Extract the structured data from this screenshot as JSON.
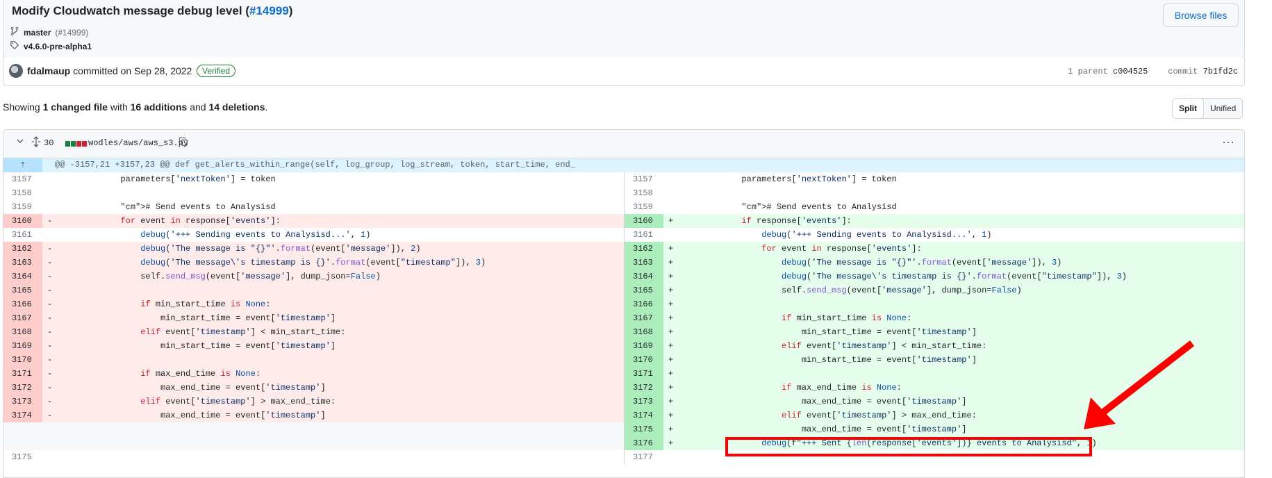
{
  "commit": {
    "title_prefix": "Modify Cloudwatch message debug level (",
    "pr_link": "#14999",
    "title_suffix": ")",
    "browse_button": "Browse files",
    "branch": "master",
    "branch_pr": "(#14999)",
    "tag": "v4.6.0-pre-alpha1",
    "author": "fdalmaup",
    "committed_text": "committed on Sep 28, 2022",
    "verified": "Verified",
    "parent_label": "1 parent",
    "parent_sha": "c004525",
    "commit_label": "commit",
    "commit_sha": "7b1fd2c"
  },
  "summary": {
    "showing": "Showing",
    "changed": "1 changed file",
    "with": "with",
    "additions": "16 additions",
    "and": "and",
    "deletions": "14 deletions",
    "period": "."
  },
  "view_toggle": {
    "split": "Split",
    "unified": "Unified"
  },
  "file": {
    "changes": "30",
    "path": "wodles/aws/aws_s3.py",
    "hunk_header": "@@ -3157,21 +3157,23 @@ def get_alerts_within_range(self, log_group, log_stream, token, start_time, end_"
  },
  "diff": {
    "left": [
      {
        "n": "3157",
        "t": "ctx",
        "m": "",
        "c": "            parameters['nextToken'] = token"
      },
      {
        "n": "3158",
        "t": "ctx",
        "m": "",
        "c": ""
      },
      {
        "n": "3159",
        "t": "ctx",
        "m": "",
        "c": "            # Send events to Analysisd"
      },
      {
        "n": "3160",
        "t": "del",
        "m": "-",
        "c": "            for event in response['events']:"
      },
      {
        "n": "3161",
        "t": "ctx",
        "m": "",
        "c": "                debug('+++ Sending events to Analysisd...', 1)"
      },
      {
        "n": "3162",
        "t": "del",
        "m": "-",
        "c": "                debug('The message is \"{}\"'.format(event['message']), 2)"
      },
      {
        "n": "3163",
        "t": "del",
        "m": "-",
        "c": "                debug('The message\\'s timestamp is {}'.format(event[\"timestamp\"]), 3)"
      },
      {
        "n": "3164",
        "t": "del",
        "m": "-",
        "c": "                self.send_msg(event['message'], dump_json=False)"
      },
      {
        "n": "3165",
        "t": "del",
        "m": "-",
        "c": ""
      },
      {
        "n": "3166",
        "t": "del",
        "m": "-",
        "c": "                if min_start_time is None:"
      },
      {
        "n": "3167",
        "t": "del",
        "m": "-",
        "c": "                    min_start_time = event['timestamp']"
      },
      {
        "n": "3168",
        "t": "del",
        "m": "-",
        "c": "                elif event['timestamp'] < min_start_time:"
      },
      {
        "n": "3169",
        "t": "del",
        "m": "-",
        "c": "                    min_start_time = event['timestamp']"
      },
      {
        "n": "3170",
        "t": "del",
        "m": "-",
        "c": ""
      },
      {
        "n": "3171",
        "t": "del",
        "m": "-",
        "c": "                if max_end_time is None:"
      },
      {
        "n": "3172",
        "t": "del",
        "m": "-",
        "c": "                    max_end_time = event['timestamp']"
      },
      {
        "n": "3173",
        "t": "del",
        "m": "-",
        "c": "                elif event['timestamp'] > max_end_time:"
      },
      {
        "n": "3174",
        "t": "del",
        "m": "-",
        "c": "                    max_end_time = event['timestamp']"
      },
      {
        "n": "",
        "t": "empty",
        "m": "",
        "c": ""
      },
      {
        "n": "",
        "t": "empty",
        "m": "",
        "c": ""
      },
      {
        "n": "3175",
        "t": "ctx",
        "m": "",
        "c": ""
      }
    ],
    "right": [
      {
        "n": "3157",
        "t": "ctx",
        "m": "",
        "c": "            parameters['nextToken'] = token"
      },
      {
        "n": "3158",
        "t": "ctx",
        "m": "",
        "c": ""
      },
      {
        "n": "3159",
        "t": "ctx",
        "m": "",
        "c": "            # Send events to Analysisd"
      },
      {
        "n": "3160",
        "t": "add",
        "m": "+",
        "c": "            if response['events']:"
      },
      {
        "n": "3161",
        "t": "ctx",
        "m": "",
        "c": "                debug('+++ Sending events to Analysisd...', 1)"
      },
      {
        "n": "3162",
        "t": "add",
        "m": "+",
        "c": "                for event in response['events']:"
      },
      {
        "n": "3163",
        "t": "add",
        "m": "+",
        "c": "                    debug('The message is \"{}\"'.format(event['message']), 3)"
      },
      {
        "n": "3164",
        "t": "add",
        "m": "+",
        "c": "                    debug('The message\\'s timestamp is {}'.format(event[\"timestamp\"]), 3)"
      },
      {
        "n": "3165",
        "t": "add",
        "m": "+",
        "c": "                    self.send_msg(event['message'], dump_json=False)"
      },
      {
        "n": "3166",
        "t": "add",
        "m": "+",
        "c": ""
      },
      {
        "n": "3167",
        "t": "add",
        "m": "+",
        "c": "                    if min_start_time is None:"
      },
      {
        "n": "3168",
        "t": "add",
        "m": "+",
        "c": "                        min_start_time = event['timestamp']"
      },
      {
        "n": "3169",
        "t": "add",
        "m": "+",
        "c": "                    elif event['timestamp'] < min_start_time:"
      },
      {
        "n": "3170",
        "t": "add",
        "m": "+",
        "c": "                        min_start_time = event['timestamp']"
      },
      {
        "n": "3171",
        "t": "add",
        "m": "+",
        "c": ""
      },
      {
        "n": "3172",
        "t": "add",
        "m": "+",
        "c": "                    if max_end_time is None:"
      },
      {
        "n": "3173",
        "t": "add",
        "m": "+",
        "c": "                        max_end_time = event['timestamp']"
      },
      {
        "n": "3174",
        "t": "add",
        "m": "+",
        "c": "                    elif event['timestamp'] > max_end_time:"
      },
      {
        "n": "3175",
        "t": "add",
        "m": "+",
        "c": "                        max_end_time = event['timestamp']"
      },
      {
        "n": "3176",
        "t": "add",
        "m": "+",
        "c": "                debug(f\"+++ Sent {len(response['events'])} events to Analysisd\", 1)"
      },
      {
        "n": "3177",
        "t": "ctx",
        "m": "",
        "c": ""
      }
    ]
  },
  "colors": {
    "annotation": "#ff0000",
    "added_bar": "#1a7f37",
    "deleted_bar": "#cf222e"
  }
}
